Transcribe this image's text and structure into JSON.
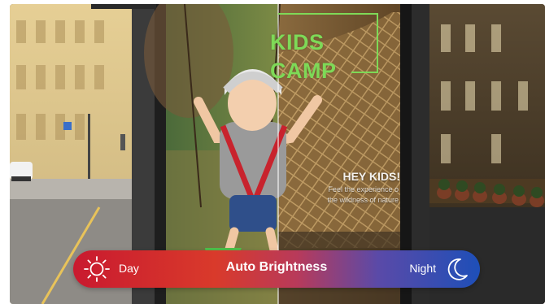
{
  "poster": {
    "title_line1": "KIDS",
    "title_line2": "CAMP",
    "headline": "HEY KIDS!",
    "body_line1": "Feel the experience o",
    "body_line2": "the wildness of nature"
  },
  "brightness_bar": {
    "day_label": "Day",
    "center_label": "Auto Brightness",
    "night_label": "Night",
    "day_icon": "sun-icon",
    "night_icon": "moon-icon",
    "gradient_start": "#c91a2f",
    "gradient_end": "#1e4fb8"
  },
  "colors": {
    "poster_title": "#7ed957",
    "bar_text": "#ffffff"
  }
}
